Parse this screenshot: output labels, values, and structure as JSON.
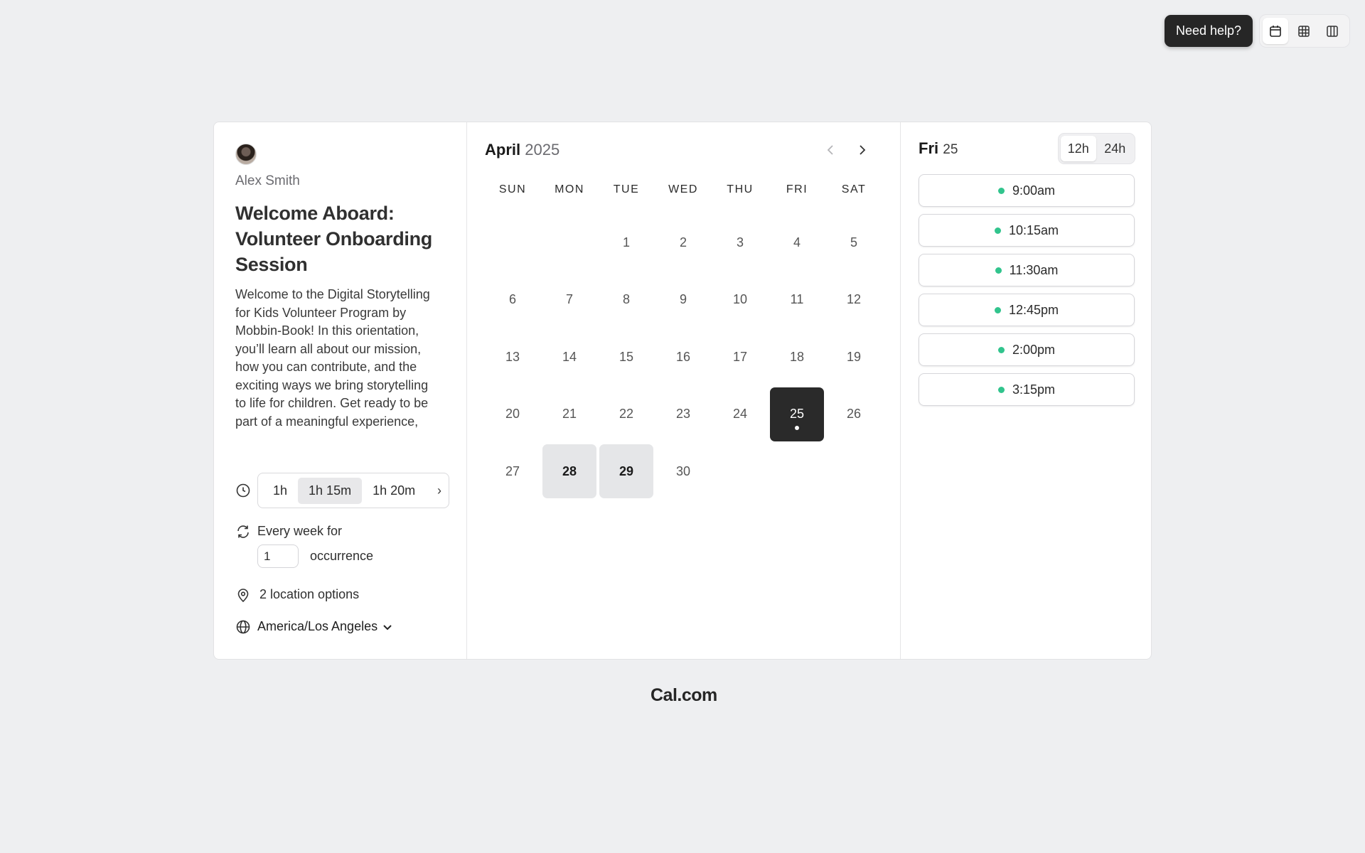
{
  "header": {
    "help_label": "Need help?",
    "view_icons": [
      "calendar-icon",
      "grid-icon",
      "columns-icon"
    ]
  },
  "event": {
    "host_name": "Alex Smith",
    "title": "Welcome Aboard: Volunteer Onboarding Session",
    "description": "Welcome to the Digital Storytelling for Kids Volunteer Program by Mobbin-Book! In this orientation, you’ll learn all about our mission, how you can contribute, and the exciting ways we bring storytelling to life for children. Get ready to be part of a meaningful experience,",
    "durations": [
      "1h",
      "1h 15m",
      "1h 20m"
    ],
    "selected_duration": "1h 15m",
    "recurrence_label": "Every week for",
    "occurrence_value": "1",
    "occurrence_label": "occurrence",
    "location_label": "2 location options",
    "timezone": "America/Los Angeles"
  },
  "calendar": {
    "month": "April",
    "year": "2025",
    "weekdays": [
      "SUN",
      "MON",
      "TUE",
      "WED",
      "THU",
      "FRI",
      "SAT"
    ],
    "leading_blanks": 2,
    "days_in_month": 30,
    "available_days": [
      28,
      29
    ],
    "selected_day": 25
  },
  "slots": {
    "day_name": "Fri",
    "day_number": "25",
    "format_options": [
      "12h",
      "24h"
    ],
    "selected_format": "12h",
    "times": [
      "9:00am",
      "10:15am",
      "11:30am",
      "12:45pm",
      "2:00pm",
      "3:15pm"
    ],
    "dot_color": "#31c48d"
  },
  "footer": {
    "brand": "Cal.com"
  }
}
